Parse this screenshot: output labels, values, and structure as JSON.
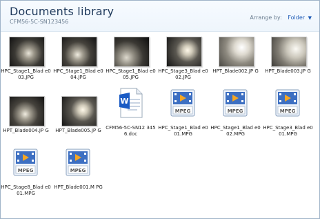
{
  "header": {
    "title": "Documents library",
    "subtitle": "CFM56-5C-SN123456",
    "arrange_label": "Arrange by:",
    "arrange_value": "Folder"
  },
  "files": [
    {
      "name": "HPC_Stage1_Blade003.JPG",
      "label": "HPC_Stage1_Blad e003.JPG",
      "kind": "jpg"
    },
    {
      "name": "HPC_Stage1_Blade004.JPG",
      "label": "HPC_Stage1_Blad e004.JPG",
      "kind": "jpg"
    },
    {
      "name": "HPC_Stage1_Blade005.JPG",
      "label": "HPC_Stage1_Blad e005.JPG",
      "kind": "jpg"
    },
    {
      "name": "HPC_Stage3_Blade002.JPG",
      "label": "HPC_Stage3_Blad e002.JPG",
      "kind": "jpg"
    },
    {
      "name": "HPT_Blade002.JPG",
      "label": "HPT_Blade002.JP G",
      "kind": "jpg"
    },
    {
      "name": "HPT_Blade003.JPG",
      "label": "HPT_Blade003.JP G",
      "kind": "jpg"
    },
    {
      "name": "HPT_Blade004.JPG",
      "label": "HPT_Blade004.JP G",
      "kind": "jpg"
    },
    {
      "name": "HPT_Blade005.JPG",
      "label": "HPT_Blade005.JP G",
      "kind": "jpg"
    },
    {
      "name": "CFM56-5C-SN123456.doc",
      "label": "CFM56-5C-SN12 3456.doc",
      "kind": "doc"
    },
    {
      "name": "HPC_Stage1_Blade001.MPG",
      "label": "HPC_Stage1_Blad e001.MPG",
      "kind": "mpg"
    },
    {
      "name": "HPC_Stage1_Blade002.MPG",
      "label": "HPC_Stage1_Blad e002.MPG",
      "kind": "mpg"
    },
    {
      "name": "HPC_Stage3_Blade001.MPG",
      "label": "HPC_Stage3_Blad e001.MPG",
      "kind": "mpg"
    },
    {
      "name": "HPC_Stage8_Blade001.MPG",
      "label": "HPC_Stage8_Blad e001.MPG",
      "kind": "mpg"
    },
    {
      "name": "HPT_Blade001.MPG",
      "label": "HPT_Blade001.M PG",
      "kind": "mpg"
    }
  ],
  "mpeg_badge": "MPEG",
  "colors": {
    "title": "#1e395b",
    "link": "#1f5bb7",
    "mpeg_blue": "#3d6fc2",
    "word_blue": "#1a5bc4"
  }
}
